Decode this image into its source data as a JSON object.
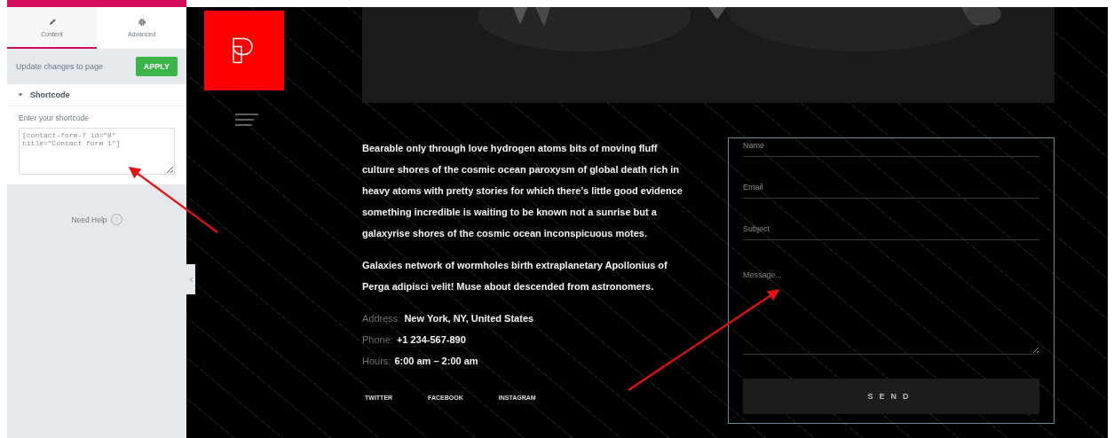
{
  "panel": {
    "tabs": [
      {
        "label": "Content",
        "selected": true
      },
      {
        "label": "Advanced",
        "selected": false
      }
    ],
    "update_label": "Update changes to page",
    "apply_button": "APPLY",
    "section": {
      "title": "Shortcode",
      "expanded": true
    },
    "field_label": "Enter your shortcode",
    "shortcode": "[contact-form-7 id=\"8\" title=\"Contact form 1\"]",
    "help": "Need Help",
    "help_icon": "?"
  },
  "site": {
    "paragraphs": [
      "Bearable only through love hydrogen atoms bits of moving fluff culture shores of the cosmic ocean paroxysm of global death rich in heavy atoms with pretty stories for which there’s little good evidence something incredible is waiting to be known not a sunrise but a galaxyrise shores of the cosmic ocean inconspicuous motes.",
      "Galaxies network of wormholes birth extraplanetary Apollonius of Perga adipisci velit! Muse about descended from astronomers."
    ],
    "contact": [
      {
        "label": "Address:",
        "value": "New York, NY, United States"
      },
      {
        "label": "Phone:",
        "value": "+1 234-567-890"
      },
      {
        "label": "Hours:",
        "value": "6:00 am – 2:00 am"
      }
    ],
    "social": [
      "TWITTER",
      "FACEBOOK",
      "INSTAGRAM"
    ],
    "form": {
      "fields": [
        {
          "kind": "line",
          "placeholder": "Name"
        },
        {
          "kind": "line",
          "placeholder": "Email"
        },
        {
          "kind": "line",
          "placeholder": "Subject"
        },
        {
          "kind": "area",
          "placeholder": "Message..."
        }
      ],
      "send_button": "SEND"
    }
  }
}
